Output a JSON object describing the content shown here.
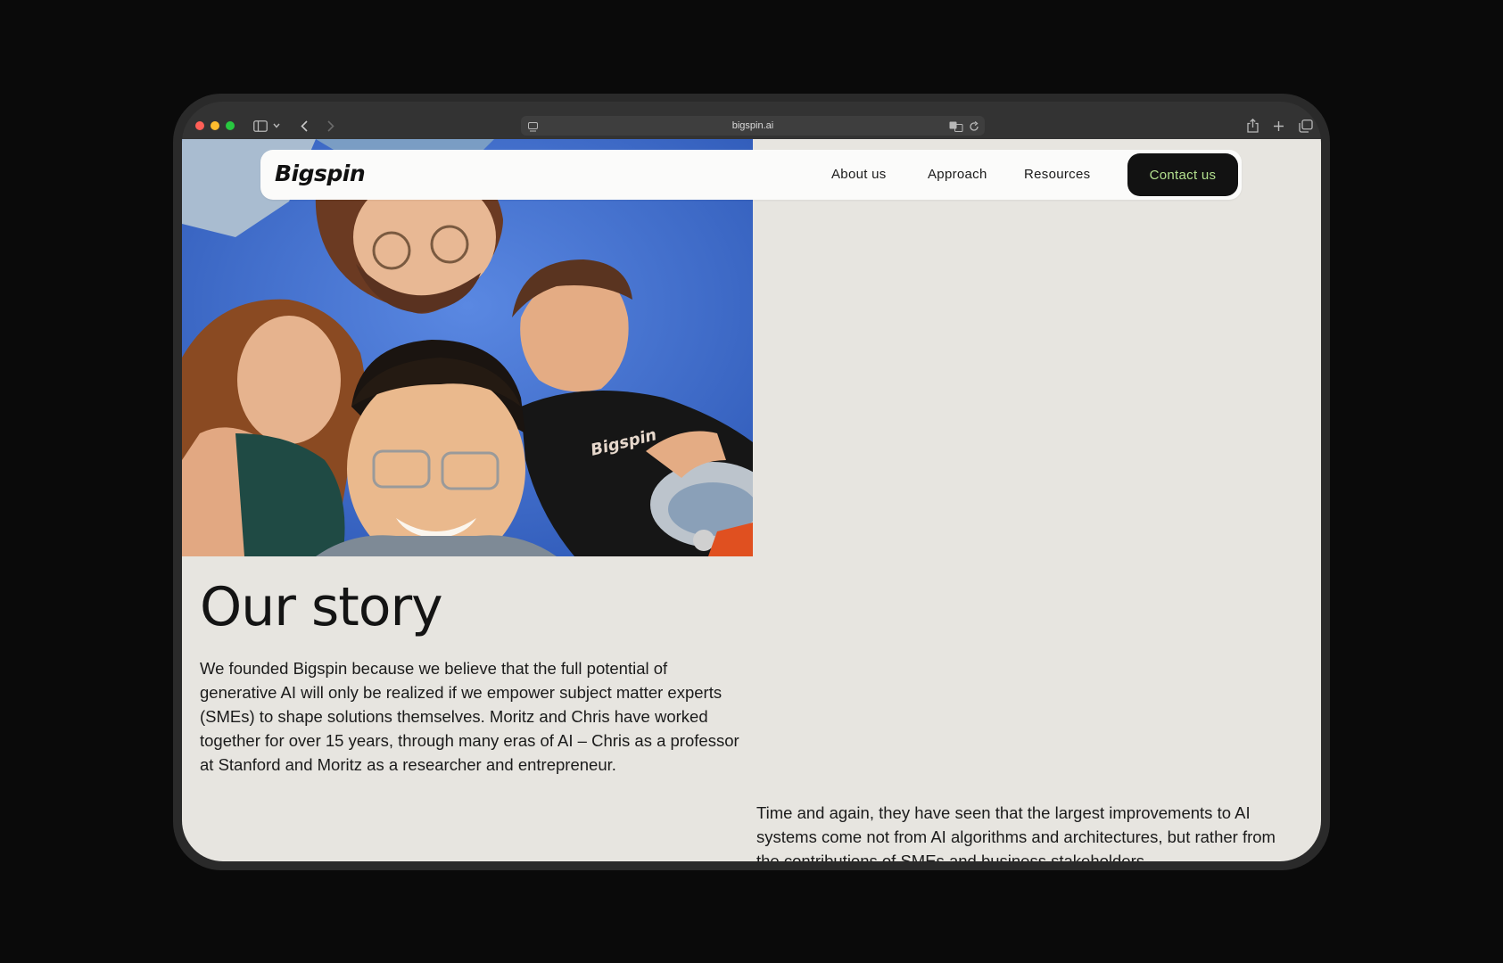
{
  "browser": {
    "url": "bigspin.ai"
  },
  "nav": {
    "logo": "Bigspin",
    "links": [
      "About us",
      "Approach",
      "Resources"
    ],
    "cta": "Contact us"
  },
  "hero": {
    "shirt_logo": "Bigspin"
  },
  "story": {
    "title": "Our story",
    "paragraph_1": "We founded Bigspin because we believe that the full potential of generative AI will only be realized if we empower subject matter experts (SMEs) to shape solutions themselves. Moritz and Chris have worked together for over 15 years, through many eras of AI – Chris as a professor at Stanford and Moritz as a researcher and entrepreneur.",
    "paragraph_2": "Time and again, they have seen that the largest improvements to AI systems come not from AI algorithms and architectures, but rather from the contributions of SMEs and business stakeholders."
  },
  "colors": {
    "page_bg": "#e7e5e0",
    "cta_bg": "#121212",
    "cta_text": "#b3e08e",
    "sky": "#4a78d8"
  }
}
